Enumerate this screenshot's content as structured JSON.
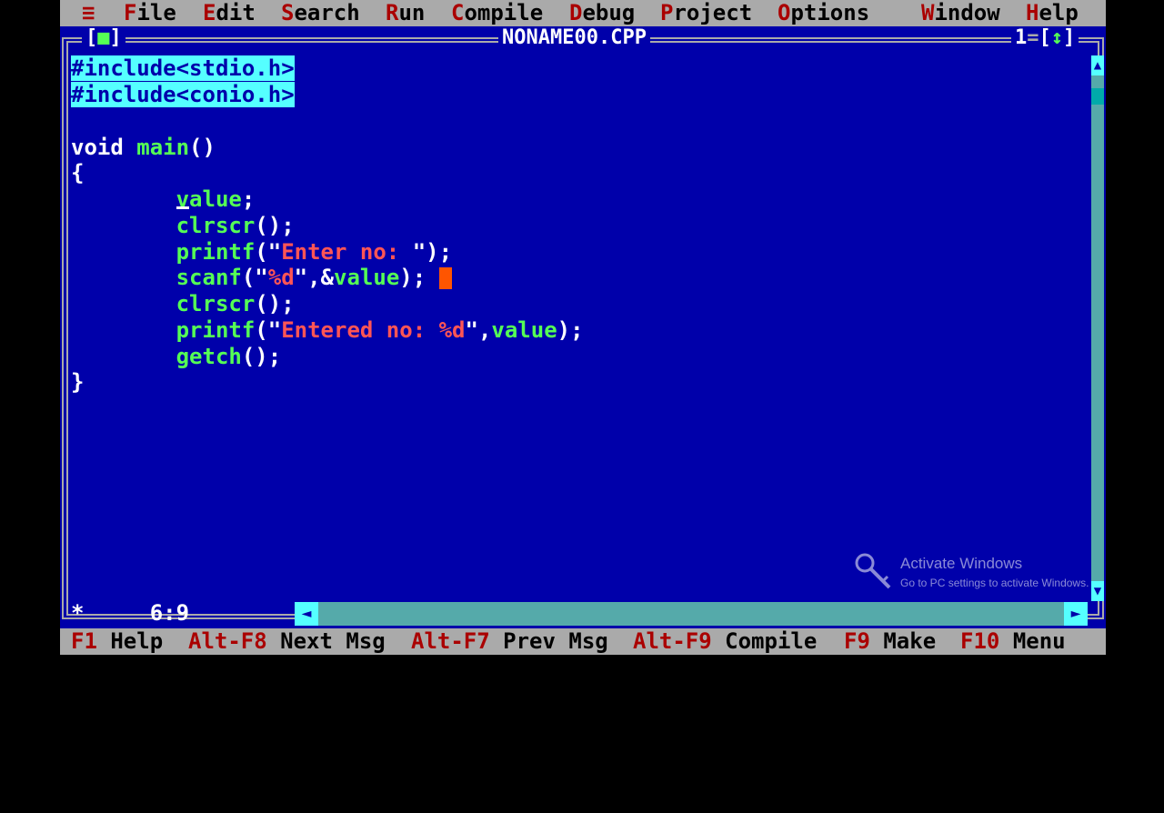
{
  "menubar": {
    "system_icon": "≡",
    "items": [
      {
        "hotkey": "F",
        "rest": "ile"
      },
      {
        "hotkey": "E",
        "rest": "dit"
      },
      {
        "hotkey": "S",
        "rest": "earch"
      },
      {
        "hotkey": "R",
        "rest": "un"
      },
      {
        "hotkey": "C",
        "rest": "ompile"
      },
      {
        "hotkey": "D",
        "rest": "ebug"
      },
      {
        "hotkey": "P",
        "rest": "roject"
      },
      {
        "hotkey": "O",
        "rest": "ptions"
      },
      {
        "hotkey": "W",
        "rest": "indow"
      },
      {
        "hotkey": "H",
        "rest": "elp"
      }
    ]
  },
  "editor": {
    "close_left": "[",
    "close_mark": "■",
    "close_right": "]",
    "filename": "NONAME00.CPP",
    "window_number": "1",
    "zoom_left": "[",
    "zoom_mark": "↕",
    "zoom_right": "]",
    "cursor_position": "6:9",
    "code": {
      "line1": "#include<stdio.h>",
      "line2": "#include<conio.h>",
      "line4_kw": "void",
      "line4_fn": "main",
      "line4_p": "()",
      "line5": "{",
      "line6_id": "value",
      "line6_p": ";",
      "line7_id": "clrscr",
      "line7_p": "();",
      "line8_id": "printf",
      "line8_p1": "(\"",
      "line8_str": "Enter no: ",
      "line8_p2": "\");",
      "line9_id": "scanf",
      "line9_p1": "(\"",
      "line9_str": "%d",
      "line9_p2": "\",&",
      "line9_id2": "value",
      "line9_p3": ");",
      "line10_id": "clrscr",
      "line10_p": "();",
      "line11_id": "printf",
      "line11_p1": "(\"",
      "line11_str": "Entered no: %d",
      "line11_p2": "\",",
      "line11_id2": "value",
      "line11_p3": ");",
      "line12_id": "getch",
      "line12_p": "();",
      "line13": "}"
    }
  },
  "helpbar": {
    "items": [
      {
        "key": "F1",
        "label": "Help"
      },
      {
        "key": "Alt-F8",
        "label": "Next Msg"
      },
      {
        "key": "Alt-F7",
        "label": "Prev Msg"
      },
      {
        "key": "Alt-F9",
        "label": "Compile"
      },
      {
        "key": "F9",
        "label": "Make"
      },
      {
        "key": "F10",
        "label": "Menu"
      }
    ]
  },
  "watermark": {
    "title": "Activate Windows",
    "subtitle": "Go to PC settings to activate Windows."
  },
  "colors": {
    "editor_bg": "#0000AA",
    "menu_bg": "#AAAAAA",
    "hotkey": "#AA0000",
    "identifier": "#55FF55",
    "string": "#FF5555",
    "highlight": "#55FFFF",
    "cursor": "#FF5500"
  }
}
